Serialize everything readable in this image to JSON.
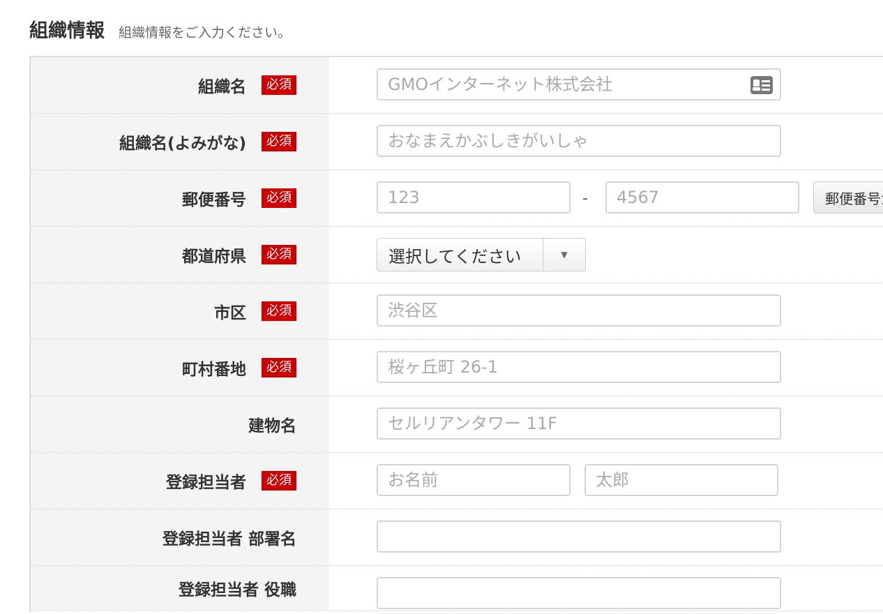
{
  "header": {
    "title": "組織情報",
    "subtitle": "組織情報をご入力ください。"
  },
  "required_label": "必須",
  "rows": [
    {
      "label": "組織名",
      "required": true,
      "placeholder": "GMOインターネット株式会社",
      "icon": "id-card-icon"
    },
    {
      "label": "組織名(よみがな)",
      "required": true,
      "placeholder": "おなまえかぶしきがいしゃ"
    },
    {
      "label": "郵便番号",
      "required": true,
      "placeholder1": "123",
      "separator": "-",
      "placeholder2": "4567",
      "button_label": "郵便番号から住所を入力"
    },
    {
      "label": "都道府県",
      "required": true,
      "select_value": "選択してください"
    },
    {
      "label": "市区",
      "required": true,
      "placeholder": "渋谷区"
    },
    {
      "label": "町村番地",
      "required": true,
      "placeholder": "桜ヶ丘町 26-1"
    },
    {
      "label": "建物名",
      "required": false,
      "placeholder": "セルリアンタワー 11F"
    },
    {
      "label": "登録担当者",
      "required": true,
      "placeholder1": "お名前",
      "placeholder2": "太郎"
    },
    {
      "label": "登録担当者 部署名",
      "required": false,
      "placeholder": ""
    },
    {
      "label": "登録担当者 役職",
      "required": false,
      "placeholder": ""
    }
  ],
  "colors": {
    "required_badge": "#cc0000",
    "label_background": "#f4f4f4"
  }
}
